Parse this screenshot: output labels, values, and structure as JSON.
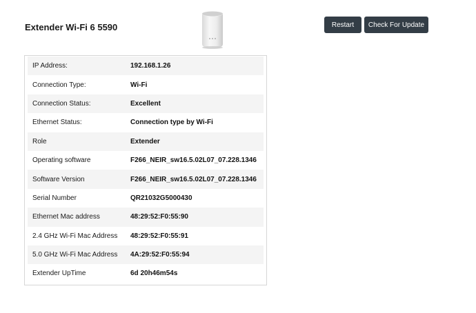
{
  "header": {
    "device_title": "Extender Wi-Fi 6 5590",
    "restart_label": "Restart",
    "update_label": "Check For Update"
  },
  "device_image": {
    "icon": "extender-device-icon"
  },
  "details": [
    {
      "label": "IP Address:",
      "value": "192.168.1.26"
    },
    {
      "label": "Connection Type:",
      "value": "Wi-Fi"
    },
    {
      "label": "Connection Status:",
      "value": "Excellent"
    },
    {
      "label": "Ethernet Status:",
      "value": "Connection type by Wi-Fi"
    },
    {
      "label": "Role",
      "value": "Extender"
    },
    {
      "label": "Operating software",
      "value": "F266_NEIR_sw16.5.02L07_07.228.1346"
    },
    {
      "label": "Software Version",
      "value": "F266_NEIR_sw16.5.02L07_07.228.1346"
    },
    {
      "label": "Serial Number",
      "value": "QR21032G5000430"
    },
    {
      "label": "Ethernet Mac address",
      "value": "48:29:52:F0:55:90"
    },
    {
      "label": "2.4 GHz Wi-Fi Mac Address",
      "value": "48:29:52:F0:55:91"
    },
    {
      "label": "5.0 GHz Wi-Fi Mac Address",
      "value": "4A:29:52:F0:55:94"
    },
    {
      "label": "Extender UpTime",
      "value": "6d 20h46m54s"
    }
  ],
  "colors": {
    "button_bg": "#333d46",
    "row_alt": "#f4f4f4",
    "border": "#d6d6d6"
  }
}
